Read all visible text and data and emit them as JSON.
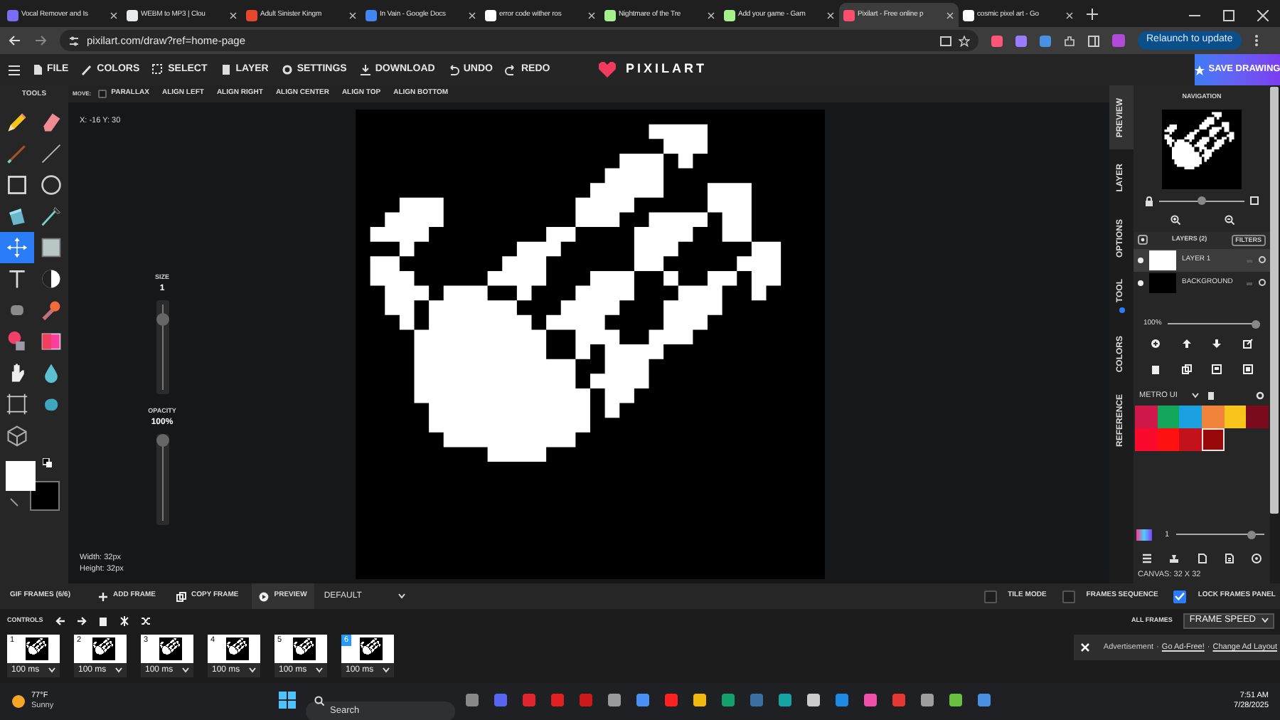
{
  "browser": {
    "tabs": [
      {
        "title": "Vocal Remover and Is",
        "selected": false
      },
      {
        "title": "WEBM to MP3 | Clou",
        "selected": false
      },
      {
        "title": "Adult Sinister Kingm",
        "selected": false
      },
      {
        "title": "In Vain - Google Docs",
        "selected": false
      },
      {
        "title": "error code wither ros",
        "selected": false
      },
      {
        "title": "Nightmare of the Tre",
        "selected": false
      },
      {
        "title": "Add your game - Gam",
        "selected": false
      },
      {
        "title": "Pixilart - Free online p",
        "selected": true
      },
      {
        "title": "cosmic pixel art - Go",
        "selected": false
      }
    ],
    "address": "pixilart.com/draw?ref=home-page",
    "relaunch": "Relaunch to update"
  },
  "app": {
    "menu": [
      {
        "kind": "file",
        "label": "FILE"
      },
      {
        "kind": "colors",
        "label": "COLORS"
      },
      {
        "kind": "select",
        "label": "SELECT"
      },
      {
        "kind": "layer",
        "label": "LAYER"
      },
      {
        "kind": "settings",
        "label": "SETTINGS"
      },
      {
        "kind": "download",
        "label": "DOWNLOAD"
      },
      {
        "kind": "undo",
        "label": "UNDO"
      },
      {
        "kind": "redo",
        "label": "REDO"
      }
    ],
    "logo": "PIXILART",
    "save": "SAVE DRAWING"
  },
  "tools": {
    "header": "TOOLS",
    "items": [
      {
        "kind": "pencil",
        "selected": false
      },
      {
        "kind": "eraser",
        "selected": false
      },
      {
        "kind": "brush",
        "selected": false
      },
      {
        "kind": "line",
        "selected": false
      },
      {
        "kind": "rectangle",
        "selected": false
      },
      {
        "kind": "ellipse",
        "selected": false
      },
      {
        "kind": "bucket",
        "selected": false
      },
      {
        "kind": "dropper",
        "selected": false
      },
      {
        "kind": "move",
        "selected": true
      },
      {
        "kind": "shape",
        "selected": false
      },
      {
        "kind": "text",
        "selected": false
      },
      {
        "kind": "lighten",
        "selected": false
      },
      {
        "kind": "dither",
        "selected": false
      },
      {
        "kind": "stamp",
        "selected": false
      },
      {
        "kind": "replace",
        "selected": false
      },
      {
        "kind": "gradient",
        "selected": false
      },
      {
        "kind": "hand",
        "selected": false
      },
      {
        "kind": "drop",
        "selected": false
      },
      {
        "kind": "select",
        "selected": false
      },
      {
        "kind": "smudge",
        "selected": false
      },
      {
        "kind": "cube",
        "selected": false
      }
    ],
    "primary": {
      "color": "#ffffff"
    },
    "secondary": {
      "color": "#000000"
    }
  },
  "options_bar": {
    "label": "MOVE:",
    "parallax": {
      "label": "PARALLAX",
      "checked": false
    },
    "buttons": [
      "ALIGN LEFT",
      "ALIGN RIGHT",
      "ALIGN CENTER",
      "ALIGN TOP",
      "ALIGN BOTTOM"
    ]
  },
  "workspace": {
    "coords": "X: -16 Y: 30",
    "size": {
      "label": "SIZE",
      "value": "1",
      "level": 0.85
    },
    "opacity": {
      "label": "OPACITY",
      "value": "100%",
      "level": 1
    },
    "width": "Width: 32px",
    "height": "Height: 32px"
  },
  "right_panel": {
    "tabs": [
      {
        "label": "PREVIEW",
        "selected": true,
        "indicator": false
      },
      {
        "label": "LAYER",
        "selected": false,
        "indicator": false
      },
      {
        "label": "OPTIONS",
        "selected": false,
        "indicator": false
      },
      {
        "label": "TOOL",
        "selected": false,
        "indicator": true
      },
      {
        "label": "COLORS",
        "selected": false,
        "indicator": false
      },
      {
        "label": "REFERENCE",
        "selected": false,
        "indicator": false
      }
    ],
    "navigation": {
      "title": "NAVIGATION",
      "level": 0.5
    },
    "layers": {
      "title": "LAYERS (2)",
      "filters": "FILTERS",
      "items": [
        {
          "name": "LAYER 1",
          "selected": true,
          "color": "#ffffff"
        },
        {
          "name": "BACKGROUND",
          "selected": false,
          "color": "#000000"
        }
      ]
    },
    "layer_opacity": {
      "value": "100%",
      "level": 1
    },
    "palette": {
      "name": "METRO UI",
      "swatches": [
        {
          "color": "#d0174a",
          "selected": false
        },
        {
          "color": "#12a75a",
          "selected": false
        },
        {
          "color": "#1ba1e2",
          "selected": false
        },
        {
          "color": "#f0843a",
          "selected": false
        },
        {
          "color": "#f8c31b",
          "selected": false
        },
        {
          "color": "#7a0b1c",
          "selected": false
        },
        {
          "color": "#fa0a2c",
          "selected": false
        },
        {
          "color": "#ff1111",
          "selected": false
        },
        {
          "color": "#c3121b",
          "selected": false
        },
        {
          "color": "#980a0a",
          "selected": true
        }
      ]
    },
    "brush": {
      "value": "1",
      "level": 0.9
    },
    "canvas_size": "CANVAS: 32 X 32"
  },
  "frames_bar": {
    "title": "GIF FRAMES (6/6)",
    "actions": [
      {
        "kind": "add",
        "label": "ADD FRAME"
      },
      {
        "kind": "copy",
        "label": "COPY FRAME"
      },
      {
        "kind": "preview",
        "label": "PREVIEW"
      }
    ],
    "preset": "DEFAULT",
    "toggles": [
      {
        "label": "TILE MODE",
        "checked": false
      },
      {
        "label": "FRAMES SEQUENCE",
        "checked": false
      },
      {
        "label": "LOCK FRAMES PANEL",
        "checked": true
      }
    ]
  },
  "controls": {
    "label": "CONTROLS",
    "all_frames": "ALL FRAMES",
    "speed": "FRAME SPEED"
  },
  "frames": [
    {
      "number": "1",
      "duration": "100 ms",
      "selected": false
    },
    {
      "number": "2",
      "duration": "100 ms",
      "selected": false
    },
    {
      "number": "3",
      "duration": "100 ms",
      "selected": false
    },
    {
      "number": "4",
      "duration": "100 ms",
      "selected": false
    },
    {
      "number": "5",
      "duration": "100 ms",
      "selected": false
    },
    {
      "number": "6",
      "duration": "100 ms",
      "selected": true
    }
  ],
  "ad": [
    {
      "kind": "text",
      "text": "Advertisement"
    },
    {
      "kind": "text",
      "text": "·"
    },
    {
      "kind": "link",
      "text": "Go Ad-Free!"
    },
    {
      "kind": "text",
      "text": "·"
    },
    {
      "kind": "link",
      "text": "Change Ad Layout"
    }
  ],
  "taskbar": {
    "weather": {
      "temp": "77°F",
      "condition": "Sunny"
    },
    "search": {
      "placeholder": "Search"
    },
    "time": "7:51 AM",
    "date": "7/28/2025"
  }
}
